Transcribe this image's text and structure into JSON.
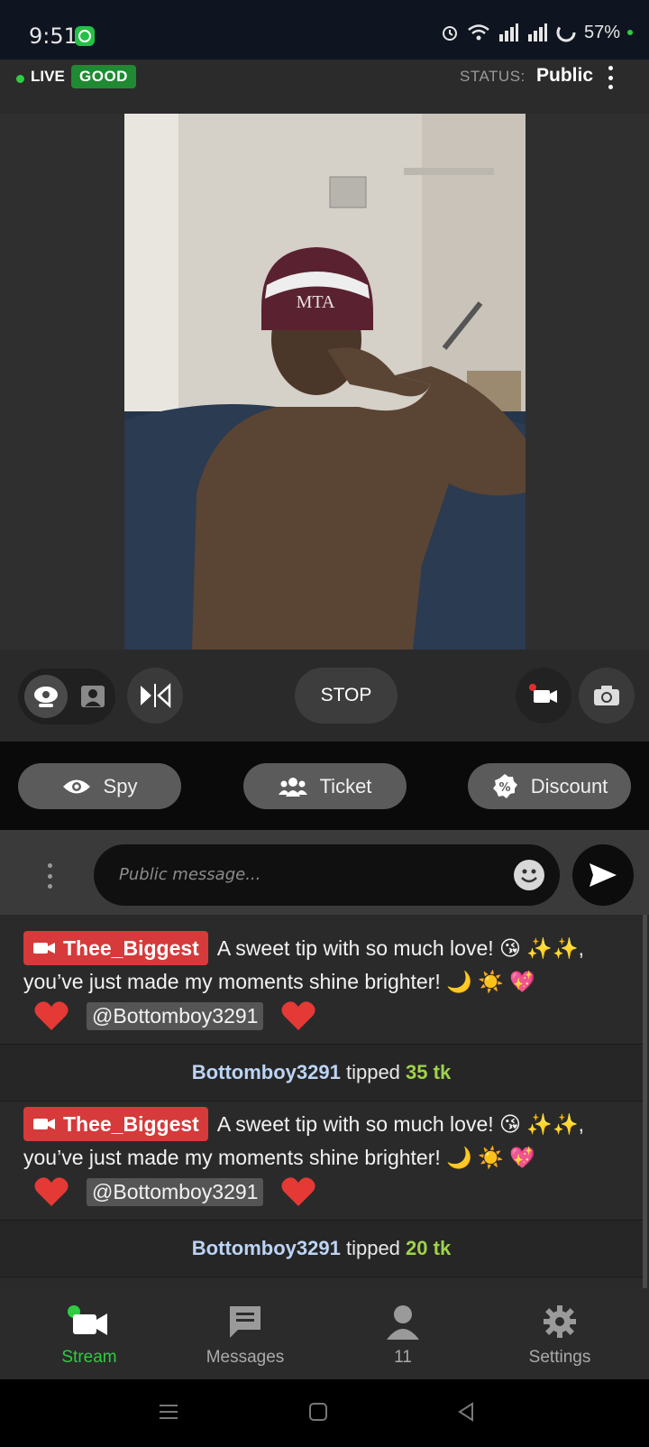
{
  "status_bar": {
    "time": "9:51",
    "battery": "57%"
  },
  "live_bar": {
    "live_label": "LIVE",
    "quality_badge": "GOOD",
    "status_label": "STATUS:",
    "status_value": "Public"
  },
  "controls": {
    "stop_label": "STOP"
  },
  "actions": [
    {
      "label": "Spy",
      "icon": "eye-icon"
    },
    {
      "label": "Ticket",
      "icon": "users-icon"
    },
    {
      "label": "Discount",
      "icon": "percent-badge-icon"
    }
  ],
  "message_input": {
    "placeholder": "Public message..."
  },
  "chat": {
    "messages": [
      {
        "user": "Thee_Biggest",
        "text_line1": "A sweet tip with so much love! 😘 ✨✨,",
        "text_line2": "you’ve just made my moments shine brighter! 🌙 ☀️ 💖",
        "mention": "@Bottomboy3291"
      },
      {
        "user": "Thee_Biggest",
        "text_line1": "A sweet tip with so much love! 😘 ✨✨,",
        "text_line2": "you’ve just made my moments shine brighter! 🌙 ☀️ 💖",
        "mention": "@Bottomboy3291"
      }
    ],
    "tips": [
      {
        "user": "Bottomboy3291",
        "verb": "tipped",
        "amount": "35 tk"
      },
      {
        "user": "Bottomboy3291",
        "verb": "tipped",
        "amount": "20 tk"
      }
    ]
  },
  "bottom_nav": [
    {
      "label": "Stream",
      "icon": "video-camera-icon",
      "active": true
    },
    {
      "label": "Messages",
      "icon": "message-icon"
    },
    {
      "label": "11",
      "icon": "person-icon"
    },
    {
      "label": "Settings",
      "icon": "gear-icon"
    }
  ],
  "colors": {
    "live_green": "#2ecc40",
    "good_badge": "#1f8a32",
    "name_badge_red": "#d63a3a",
    "tip_amount_green": "#9fd34a",
    "stream_active": "#2ecc40"
  }
}
